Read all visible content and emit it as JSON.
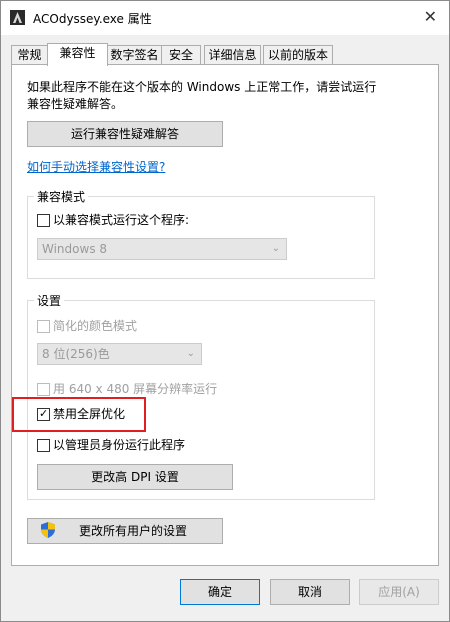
{
  "window": {
    "title": "ACOdyssey.exe 属性",
    "close_glyph": "✕"
  },
  "tabs": [
    {
      "label": "常规"
    },
    {
      "label": "兼容性"
    },
    {
      "label": "数字签名"
    },
    {
      "label": "安全"
    },
    {
      "label": "详细信息"
    },
    {
      "label": "以前的版本"
    }
  ],
  "compat": {
    "intro": "如果此程序不能在这个版本的 Windows 上正常工作，请尝试运行兼容性疑难解答。",
    "run_troubleshooter": "运行兼容性疑难解答",
    "manual_link": "如何手动选择兼容性设置?"
  },
  "compat_mode": {
    "group_title": "兼容模式",
    "checkbox_label": "以兼容模式运行这个程序:",
    "os_select": "Windows 8"
  },
  "settings": {
    "group_title": "设置",
    "reduced_color": "简化的颜色模式",
    "color_select": "8 位(256)色",
    "run_640": "用 640 x 480 屏幕分辨率运行",
    "disable_fullscreen": "禁用全屏优化",
    "run_as_admin": "以管理员身份运行此程序",
    "high_dpi": "更改高 DPI 设置"
  },
  "change_all_users": "更改所有用户的设置",
  "footer": {
    "ok": "确定",
    "cancel": "取消",
    "apply": "应用(A)"
  },
  "checkmark_glyph": "✓",
  "chevron_glyph": "⌄",
  "colors": {
    "accent": "#0078d7",
    "highlight": "#e02020",
    "link": "#0066cc"
  }
}
